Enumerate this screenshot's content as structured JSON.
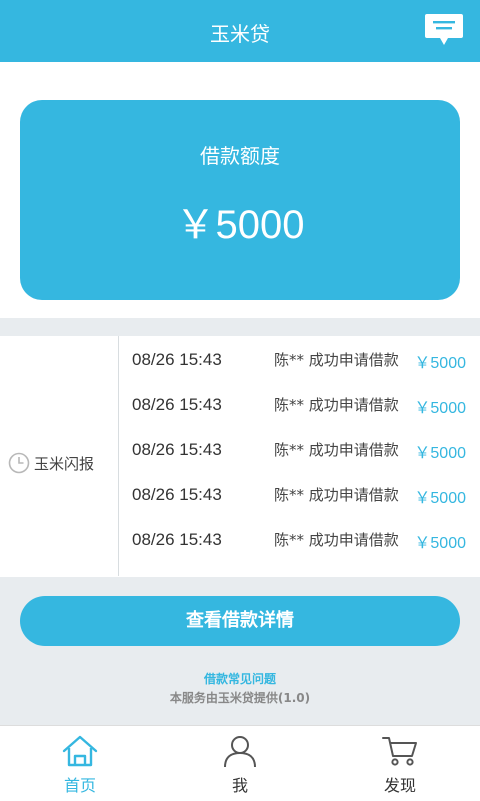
{
  "header": {
    "title": "玉米贷",
    "message_icon": "message-icon"
  },
  "card": {
    "label": "借款额度",
    "amount": "￥5000"
  },
  "news": {
    "label": "玉米闪报",
    "items": [
      {
        "time": "08/26 15:43",
        "text": "陈** 成功申请借款",
        "amount": "￥5000"
      },
      {
        "time": "08/26 15:43",
        "text": "陈** 成功申请借款",
        "amount": "￥5000"
      },
      {
        "time": "08/26 15:43",
        "text": "陈** 成功申请借款",
        "amount": "￥5000"
      },
      {
        "time": "08/26 15:43",
        "text": "陈** 成功申请借款",
        "amount": "￥5000"
      },
      {
        "time": "08/26 15:43",
        "text": "陈** 成功申请借款",
        "amount": "￥5000"
      }
    ]
  },
  "actions": {
    "detail_button": "查看借款详情"
  },
  "footer": {
    "faq": "借款常见问题",
    "provider": "本服务由玉米贷提供(1.0)"
  },
  "tabs": [
    {
      "label": "首页",
      "icon": "home-icon",
      "active": true
    },
    {
      "label": "我",
      "icon": "user-icon",
      "active": false
    },
    {
      "label": "发现",
      "icon": "cart-icon",
      "active": false
    }
  ],
  "colors": {
    "accent": "#35b7e0",
    "band": "#e8ecef",
    "text": "#333333"
  }
}
